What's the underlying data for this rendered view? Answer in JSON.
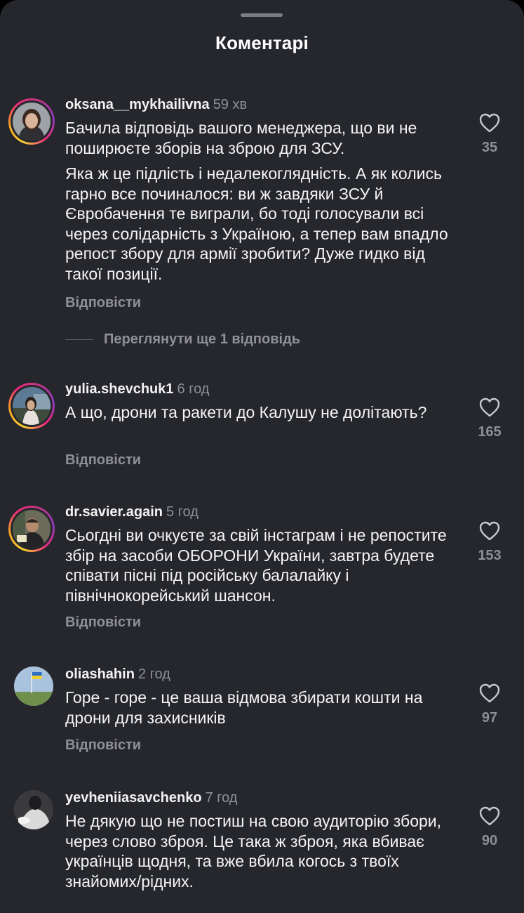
{
  "header": {
    "title": "Коментарі"
  },
  "reply_label": "Відповісти",
  "view_more_replies": "Переглянути ще 1 відповідь",
  "comments": [
    {
      "username": "oksana__mykhailivna",
      "time": "59 хв",
      "paragraphs": [
        "Бачила відповідь вашого менеджера, що ви не поширюєте зборів на зброю для ЗСУ.",
        "Яка ж це підлість і недалекоглядність. А як колись гарно все починалося: ви ж завдяки ЗСУ й Євробачення те виграли, бо тоді голосували всі через солідарність з Україною, а тепер вам впадло репост збору для армії зробити? Дуже гидко від такої позиції."
      ],
      "likes": "35",
      "reply": "Відповісти",
      "has_story_ring": true
    },
    {
      "username": "yulia.shevchuk1",
      "time": "6 год",
      "paragraphs": [
        "А що, дрони та ракети до Калушу не долітають?"
      ],
      "likes": "165",
      "reply": "Відповісти",
      "has_story_ring": true
    },
    {
      "username": "dr.savier.again",
      "time": "5 год",
      "paragraphs": [
        "Сьогдні ви очкуєте за свій інстаграм і не репостите збір на засоби ОБОРОНИ України, завтра будете співати пісні під російську балалайку і північнокорейський шансон."
      ],
      "likes": "153",
      "reply": "Відповісти",
      "has_story_ring": true
    },
    {
      "username": "oliashahin",
      "time": "2 год",
      "paragraphs": [
        "Горе - горе - це ваша відмова збирати кошти на дрони для захисників"
      ],
      "likes": "97",
      "reply": "Відповісти",
      "has_story_ring": false
    },
    {
      "username": "yevheniiasavchenko",
      "time": "7 год",
      "paragraphs": [
        "Не дякую що не постиш на свою аудиторію збори, через слово зброя. Це така ж зброя, яка вбиває українців щодня, та вже вбила когось з твоїх знайомих/рідних."
      ],
      "likes": "90",
      "has_story_ring": false
    }
  ],
  "icons": {
    "like": "heart-outline-icon"
  },
  "colors": {
    "background": "#26272c",
    "text": "#f5f5f5",
    "muted": "#8f9096",
    "story_ring": [
      "#f9ce34",
      "#ee2a7b",
      "#8a3ab9"
    ]
  }
}
